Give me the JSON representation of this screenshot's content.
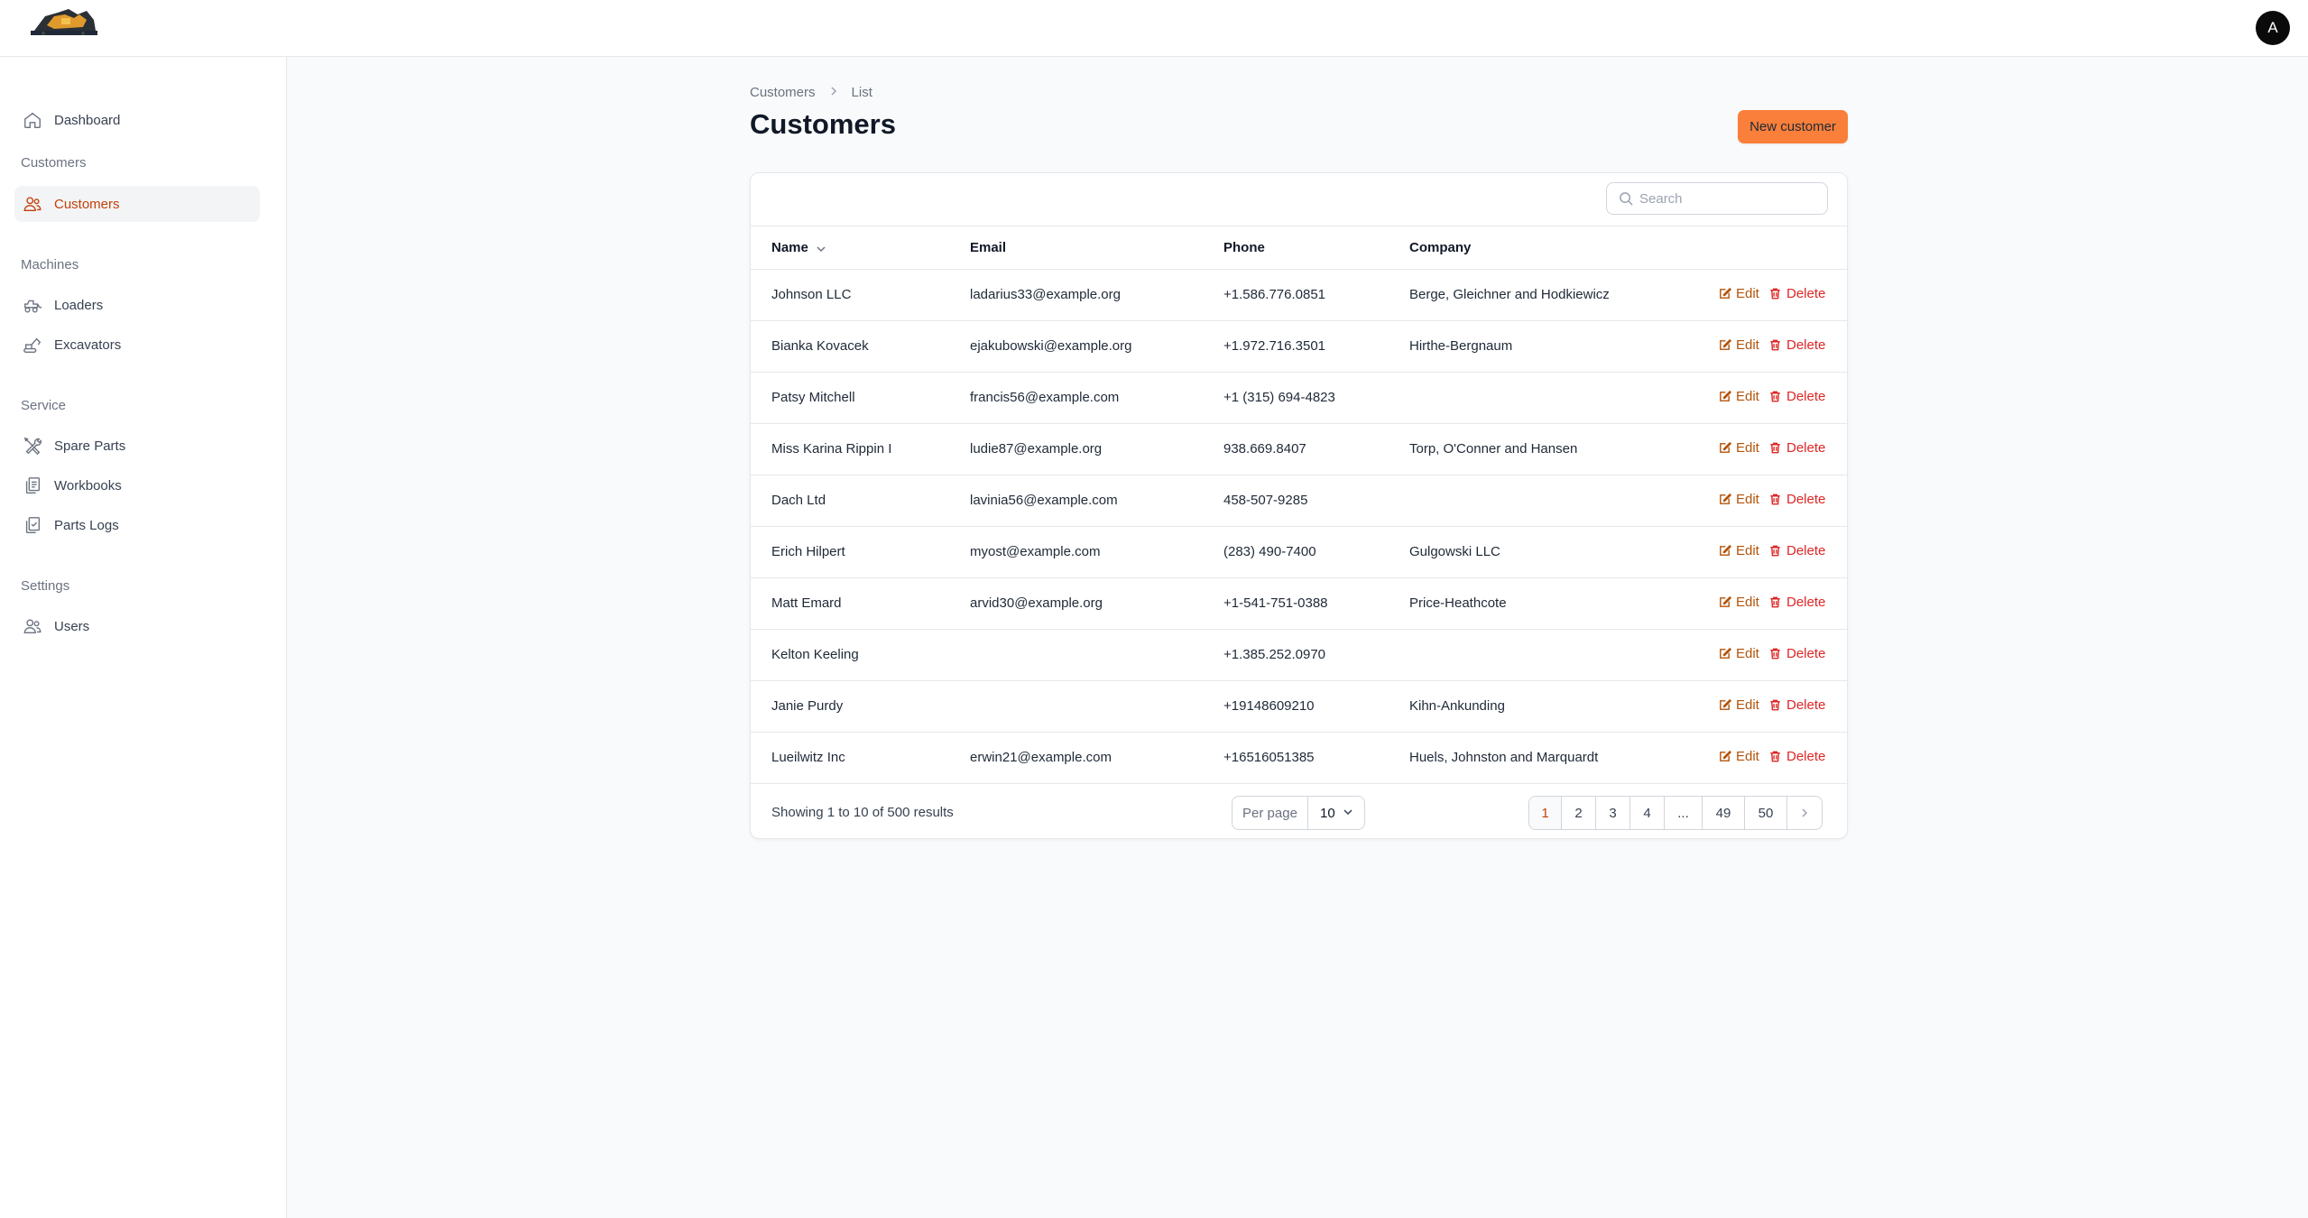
{
  "header": {
    "logo_icon": "excavator-logo-icon",
    "avatar_letter": "A"
  },
  "sidebar": {
    "dashboard": {
      "label": "Dashboard",
      "icon": "home-icon"
    },
    "groups": {
      "customers": "Customers",
      "machines": "Machines",
      "service": "Service",
      "settings": "Settings"
    },
    "items": {
      "customers": {
        "label": "Customers",
        "icon": "users-icon",
        "active": true
      },
      "loaders": {
        "label": "Loaders",
        "icon": "loader-icon"
      },
      "excavators": {
        "label": "Excavators",
        "icon": "excavator-icon"
      },
      "spare_parts": {
        "label": "Spare Parts",
        "icon": "wrench-screwdriver-icon"
      },
      "workbooks": {
        "label": "Workbooks",
        "icon": "documents-icon"
      },
      "parts_logs": {
        "label": "Parts Logs",
        "icon": "clipboard-check-icon"
      },
      "users": {
        "label": "Users",
        "icon": "users-icon"
      }
    }
  },
  "breadcrumb": {
    "first": "Customers",
    "second": "List"
  },
  "page": {
    "title": "Customers",
    "new_button": "New customer"
  },
  "search": {
    "placeholder": "Search"
  },
  "table": {
    "headers": {
      "name": "Name",
      "email": "Email",
      "phone": "Phone",
      "company": "Company"
    },
    "actions": {
      "edit": "Edit",
      "delete": "Delete"
    },
    "rows": [
      {
        "name": "Johnson LLC",
        "email": "ladarius33@example.org",
        "phone": "+1.586.776.0851",
        "company": "Berge, Gleichner and Hodkiewicz"
      },
      {
        "name": "Bianka Kovacek",
        "email": "ejakubowski@example.org",
        "phone": "+1.972.716.3501",
        "company": "Hirthe-Bergnaum"
      },
      {
        "name": "Patsy Mitchell",
        "email": "francis56@example.com",
        "phone": "+1 (315) 694-4823",
        "company": ""
      },
      {
        "name": "Miss Karina Rippin I",
        "email": "ludie87@example.org",
        "phone": "938.669.8407",
        "company": "Torp, O'Conner and Hansen"
      },
      {
        "name": "Dach Ltd",
        "email": "lavinia56@example.com",
        "phone": "458-507-9285",
        "company": ""
      },
      {
        "name": "Erich Hilpert",
        "email": "myost@example.com",
        "phone": "(283) 490-7400",
        "company": "Gulgowski LLC"
      },
      {
        "name": "Matt Emard",
        "email": "arvid30@example.org",
        "phone": "+1-541-751-0388",
        "company": "Price-Heathcote"
      },
      {
        "name": "Kelton Keeling",
        "email": "",
        "phone": "+1.385.252.0970",
        "company": ""
      },
      {
        "name": "Janie Purdy",
        "email": "",
        "phone": "+19148609210",
        "company": "Kihn-Ankunding"
      },
      {
        "name": "Lueilwitz Inc",
        "email": "erwin21@example.com",
        "phone": "+16516051385",
        "company": "Huels, Johnston and Marquardt"
      }
    ]
  },
  "footer": {
    "showing": "Showing 1 to 10 of 500 results",
    "per_page_label": "Per page",
    "per_page_value": "10",
    "pages": [
      "1",
      "2",
      "3",
      "4",
      "...",
      "49",
      "50"
    ],
    "active_page": "1"
  },
  "colors": {
    "accent": "#f97f3a",
    "active_text": "#c2410c",
    "edit": "#b45309",
    "delete": "#dc2626"
  }
}
